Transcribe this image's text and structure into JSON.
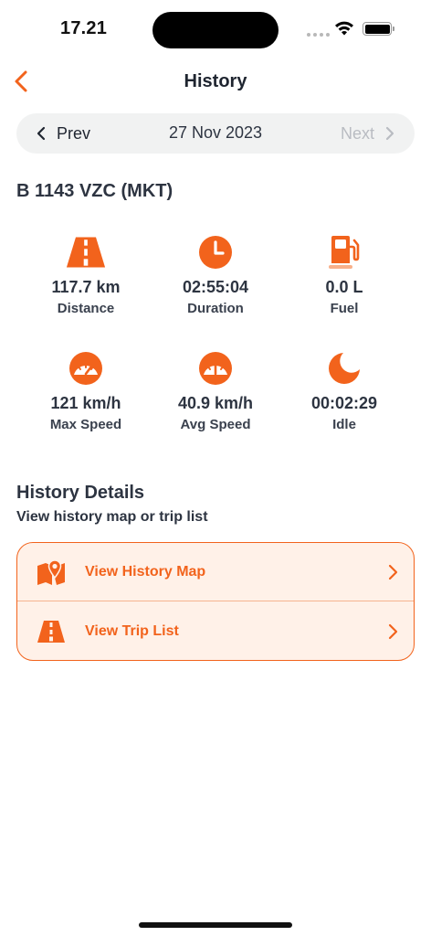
{
  "status_bar": {
    "time": "17.21"
  },
  "header": {
    "title": "History"
  },
  "date_nav": {
    "prev_label": "Prev",
    "date": "27 Nov 2023",
    "next_label": "Next"
  },
  "vehicle": {
    "plate": "B 1143 VZC (MKT)"
  },
  "stats": [
    {
      "icon": "road-icon",
      "value": "117.7 km",
      "label": "Distance"
    },
    {
      "icon": "clock-icon",
      "value": "02:55:04",
      "label": "Duration"
    },
    {
      "icon": "fuel-pump-icon",
      "value": "0.0 L",
      "label": "Fuel"
    },
    {
      "icon": "speedometer-icon",
      "value": "121 km/h",
      "label": "Max Speed"
    },
    {
      "icon": "speedometer-icon",
      "value": "40.9 km/h",
      "label": "Avg Speed"
    },
    {
      "icon": "moon-icon",
      "value": "00:02:29",
      "label": "Idle"
    }
  ],
  "details": {
    "title": "History Details",
    "subtitle": "View history map or trip list",
    "items": [
      {
        "icon": "map-pin-icon",
        "label": "View History Map"
      },
      {
        "icon": "road-icon",
        "label": "View Trip List"
      }
    ]
  },
  "colors": {
    "accent": "#f2631c",
    "accent_light": "#fff1e8",
    "text": "#2d3441",
    "muted": "#b9bcc2"
  }
}
